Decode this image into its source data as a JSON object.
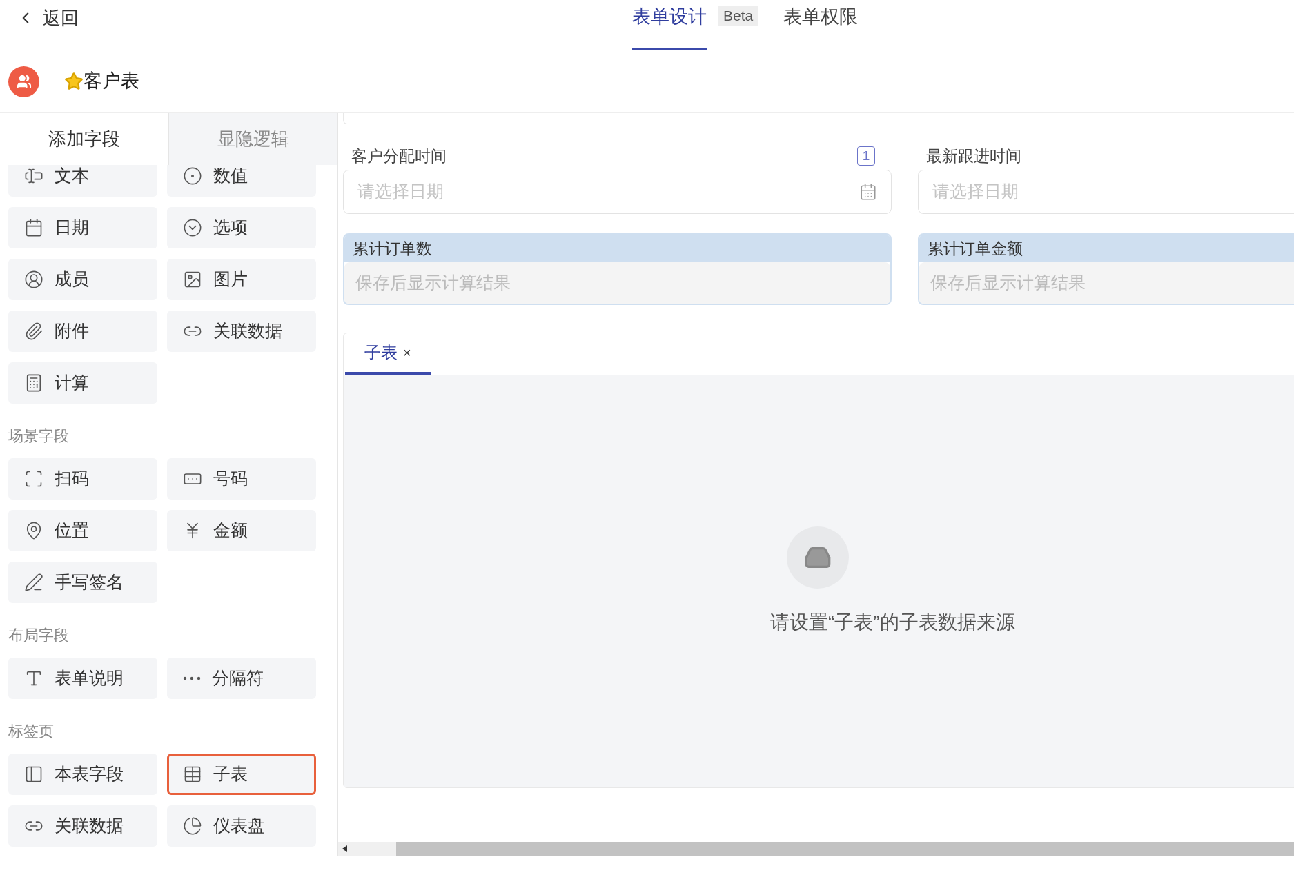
{
  "top_bar": {
    "back": "返回",
    "tabs": [
      {
        "label": "表单设计",
        "selected": true,
        "badge": "Beta"
      },
      {
        "label": "表单权限",
        "selected": false
      }
    ]
  },
  "form": {
    "title": "客户表",
    "starred": true
  },
  "panel_tabs": [
    {
      "label": "添加字段",
      "selected": true
    },
    {
      "label": "显隐逻辑",
      "selected": false
    }
  ],
  "field_groups": [
    {
      "fields": [
        {
          "label": "文本",
          "kind": "text",
          "selected": false
        },
        {
          "label": "数值",
          "kind": "number",
          "selected": false
        },
        {
          "label": "日期",
          "kind": "date",
          "selected": false
        },
        {
          "label": "选项",
          "kind": "select",
          "selected": false
        },
        {
          "label": "成员",
          "kind": "member",
          "selected": false
        },
        {
          "label": "图片",
          "kind": "image",
          "selected": false
        },
        {
          "label": "附件",
          "kind": "attachment",
          "selected": false
        },
        {
          "label": "关联数据",
          "kind": "relation",
          "selected": false
        },
        {
          "label": "计算",
          "kind": "formula",
          "selected": false
        }
      ]
    },
    {
      "title": "场景字段",
      "fields": [
        {
          "label": "扫码",
          "kind": "scan",
          "selected": false
        },
        {
          "label": "号码",
          "kind": "serial",
          "selected": false
        },
        {
          "label": "位置",
          "kind": "location",
          "selected": false
        },
        {
          "label": "金额",
          "kind": "amount",
          "selected": false
        },
        {
          "label": "手写签名",
          "kind": "signature",
          "selected": false
        }
      ]
    },
    {
      "title": "布局字段",
      "fields": [
        {
          "label": "表单说明",
          "kind": "description",
          "selected": false
        },
        {
          "label": "分隔符",
          "kind": "divider",
          "selected": false
        }
      ]
    },
    {
      "title": "标签页",
      "fields": [
        {
          "label": "本表字段",
          "kind": "tab",
          "selected": false
        },
        {
          "label": "子表",
          "kind": "subtable",
          "selected": true
        },
        {
          "label": "关联数据",
          "kind": "relation",
          "selected": false
        },
        {
          "label": "仪表盘",
          "kind": "dashboard",
          "selected": false
        }
      ]
    }
  ],
  "canvas_fields": [
    {
      "label": "客户分配时间",
      "kind": "date",
      "placeholder": "请选择日期",
      "badge": "1",
      "calendar_icon": true
    },
    {
      "label": "最新跟进时间",
      "kind": "date",
      "placeholder": "请选择日期"
    },
    {
      "label": "累计订单数",
      "kind": "calculated",
      "value": "保存后显示计算结果"
    },
    {
      "label": "累计订单金额",
      "kind": "calculated",
      "value": "保存后显示计算结果"
    }
  ],
  "subtable_tab": {
    "tabs": [
      {
        "label": "子表",
        "selected": true,
        "close": "×"
      }
    ],
    "empty_message": "请设置“子表”的子表数据来源"
  }
}
